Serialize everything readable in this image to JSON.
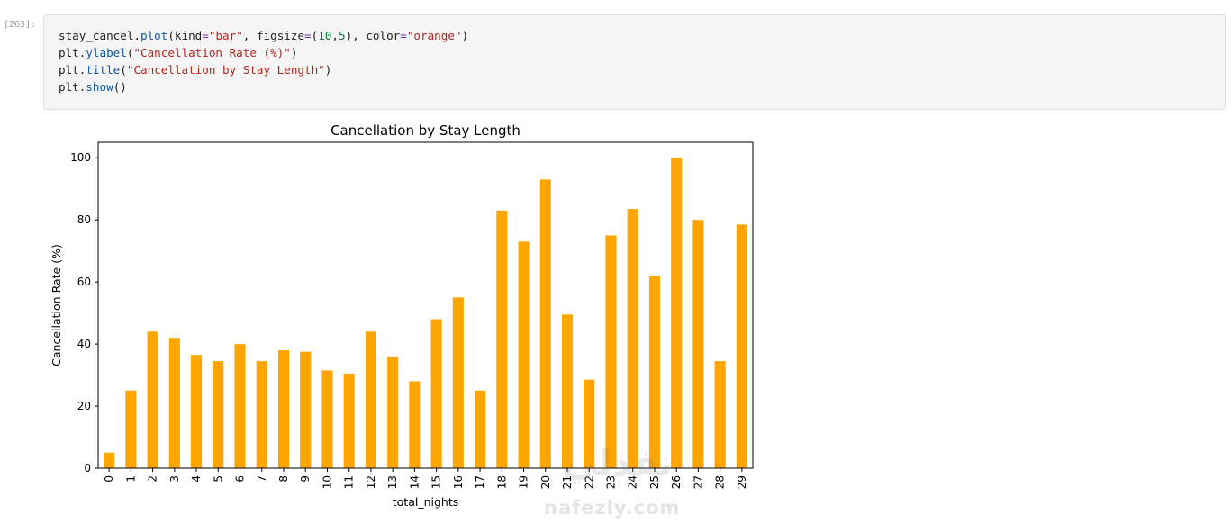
{
  "cell": {
    "prompt": "[263]:",
    "code_lines": [
      [
        {
          "t": "stay_cancel."
        },
        {
          "t": "plot",
          "c": "fn"
        },
        {
          "t": "(kind"
        },
        {
          "t": "=",
          "c": "eq"
        },
        {
          "t": "\"bar\"",
          "c": "str"
        },
        {
          "t": ", figsize"
        },
        {
          "t": "=",
          "c": "eq"
        },
        {
          "t": "("
        },
        {
          "t": "10",
          "c": "num"
        },
        {
          "t": ","
        },
        {
          "t": "5",
          "c": "num"
        },
        {
          "t": "), color"
        },
        {
          "t": "=",
          "c": "eq"
        },
        {
          "t": "\"orange\"",
          "c": "str"
        },
        {
          "t": ")"
        }
      ],
      [
        {
          "t": "plt."
        },
        {
          "t": "ylabel",
          "c": "fn"
        },
        {
          "t": "("
        },
        {
          "t": "\"Cancellation Rate (%)\"",
          "c": "str"
        },
        {
          "t": ")"
        }
      ],
      [
        {
          "t": "plt."
        },
        {
          "t": "title",
          "c": "fn"
        },
        {
          "t": "("
        },
        {
          "t": "\"Cancellation by Stay Length\"",
          "c": "str"
        },
        {
          "t": ")"
        }
      ],
      [
        {
          "t": "plt."
        },
        {
          "t": "show",
          "c": "fn"
        },
        {
          "t": "()"
        }
      ]
    ]
  },
  "chart_data": {
    "type": "bar",
    "title": "Cancellation by Stay Length",
    "xlabel": "total_nights",
    "ylabel": "Cancellation Rate (%)",
    "categories": [
      "0",
      "1",
      "2",
      "3",
      "4",
      "5",
      "6",
      "7",
      "8",
      "9",
      "10",
      "11",
      "12",
      "13",
      "14",
      "15",
      "16",
      "17",
      "18",
      "19",
      "20",
      "21",
      "22",
      "23",
      "24",
      "25",
      "26",
      "27",
      "28",
      "29"
    ],
    "values": [
      5,
      25,
      44,
      42,
      36.5,
      34.5,
      40,
      34.5,
      38,
      37.5,
      31.5,
      30.5,
      44,
      36,
      28,
      48,
      55,
      25,
      83,
      73,
      93,
      49.5,
      28.5,
      75,
      83.5,
      62,
      100,
      80,
      34.5,
      78.5
    ],
    "ylim": [
      0,
      105
    ],
    "yticks": [
      0,
      20,
      40,
      60,
      80,
      100
    ],
    "color": "#ffa500",
    "grid": false,
    "legend": "none"
  },
  "watermark": {
    "arabic": "نفذلي",
    "latin": "nafezly.com"
  }
}
